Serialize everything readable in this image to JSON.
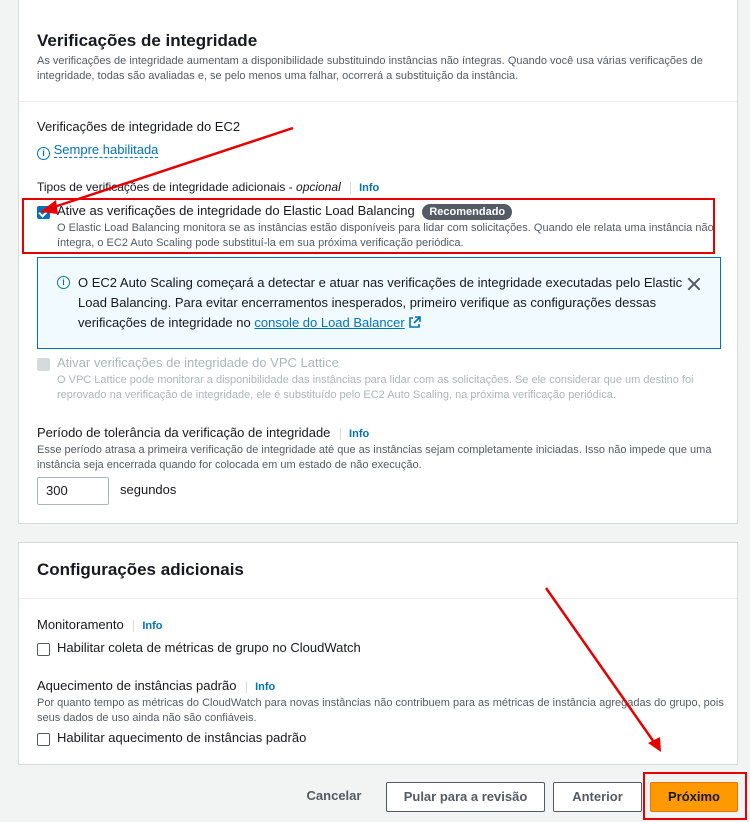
{
  "health_checks": {
    "title": "Verificações de integridade",
    "description": "As verificações de integridade aumentam a disponibilidade substituindo instâncias não íntegras. Quando você usa várias verificações de integridade, todas são avaliadas e, se pelo menos uma falhar, ocorrerá a substituição da instância.",
    "ec2_label": "Verificações de integridade do EC2",
    "ec2_status": "Sempre habilitada",
    "additional_label": "Tipos de verificações de integridade adicionais -",
    "additional_optional": "opcional",
    "info": "Info",
    "elb": {
      "label": "Ative as verificações de integridade do Elastic Load Balancing",
      "badge": "Recomendado",
      "description": "O Elastic Load Balancing monitora se as instâncias estão disponíveis para lidar com solicitações. Quando ele relata uma instância não íntegra, o EC2 Auto Scaling pode substituí-la em sua próxima verificação periódica.",
      "checked": true
    },
    "alert": {
      "text_line1": "O EC2 Auto Scaling começará a detectar e atuar nas verificações de integridade executadas pelo Elastic",
      "text_line2": "Load Balancing. Para evitar encerramentos inesperados, primeiro verifique as configurações dessas",
      "text_line3": "verificações de integridade no",
      "link": "console do Load Balancer"
    },
    "vpc": {
      "label": "Ativar verificações de integridade do VPC Lattice",
      "description": "O VPC Lattice pode monitorar a disponibilidade das instâncias para lidar com as solicitações. Se ele considerar que um destino foi reprovado na verificação de integridade, ele é substituído pelo EC2 Auto Scaling, na próxima verificação periódica."
    },
    "grace": {
      "label": "Período de tolerância da verificação de integridade",
      "description": "Esse período atrasa a primeira verificação de integridade até que as instâncias sejam completamente iniciadas. Isso não impede que uma instância seja encerrada quando for colocada em um estado de não execução.",
      "value": "300",
      "unit": "segundos"
    }
  },
  "additional": {
    "title": "Configurações adicionais",
    "monitoring_label": "Monitoramento",
    "monitoring_checkbox": "Habilitar coleta de métricas de grupo no CloudWatch",
    "warmup_label": "Aquecimento de instâncias padrão",
    "warmup_description": "Por quanto tempo as métricas do CloudWatch para novas instâncias não contribuem para as métricas de instância agregadas do grupo, pois seus dados de uso ainda não são confiáveis.",
    "warmup_checkbox": "Habilitar aquecimento de instâncias padrão",
    "info": "Info"
  },
  "footer": {
    "cancel": "Cancelar",
    "skip": "Pular para a revisão",
    "previous": "Anterior",
    "next": "Próximo"
  },
  "colors": {
    "primary": "#ff9900",
    "link": "#0073bb",
    "annotation": "#e60000"
  }
}
